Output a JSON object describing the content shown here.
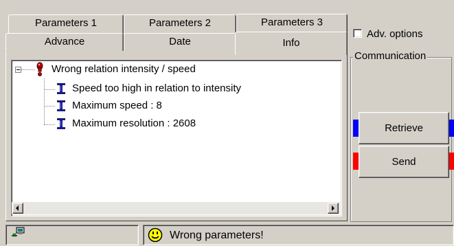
{
  "tabs_row1": [
    {
      "label": "Parameters 1"
    },
    {
      "label": "Parameters 2"
    },
    {
      "label": "Parameters 3"
    }
  ],
  "tabs_row2": [
    {
      "label": "Advance"
    },
    {
      "label": "Date"
    },
    {
      "label": "Info",
      "active": true
    }
  ],
  "tree": {
    "root": {
      "label": "Wrong relation intensity / speed",
      "icon": "exclamation-icon",
      "expanded": true
    },
    "children": [
      {
        "label": "Speed too high in relation to intensity",
        "icon": "i-beam-icon"
      },
      {
        "label": "Maximum speed : 8",
        "icon": "i-beam-icon"
      },
      {
        "label": "Maximum resolution : 2608",
        "icon": "i-beam-icon"
      }
    ]
  },
  "side": {
    "adv_options_label": "Adv. options",
    "adv_options_checked": false,
    "group_label": "Communication",
    "retrieve_label": "Retrieve",
    "send_label": "Send",
    "retrieve_indicator_color": "#0000ff",
    "send_indicator_color": "#ff0000"
  },
  "status": {
    "message": "Wrong parameters!",
    "message_icon": "smiley-icon",
    "left_icon": "network-computer-icon"
  }
}
